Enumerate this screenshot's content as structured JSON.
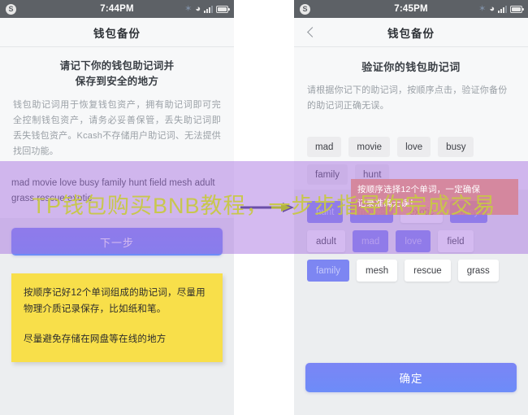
{
  "left_phone": {
    "status_bar": {
      "badge": "S",
      "time": "7:44PM",
      "bluetooth_icon": "bluetooth-icon",
      "wifi_icon": "wifi-icon",
      "signal_icon": "signal-icon",
      "battery_icon": "battery-icon"
    },
    "nav": {
      "title": "钱包备份"
    },
    "hero": {
      "title_line1": "请记下你的钱包助记词并",
      "title_line2": "保存到安全的地方",
      "description": "钱包助记词用于恢复钱包资产，拥有助记词即可完全控制钱包资产，请务必妥善保管，丢失助记词即丢失钱包资产。Kcash不存储用户助记词、无法提供找回功能。"
    },
    "mnemonic": {
      "line1": "mad movie love busy family hunt field mesh adult",
      "line2": "grass rescue exotic",
      "words": [
        "mad",
        "movie",
        "love",
        "busy",
        "family",
        "hunt",
        "field",
        "mesh",
        "adult",
        "grass",
        "rescue",
        "exotic"
      ]
    },
    "next_button": "下一步",
    "note": {
      "paragraph1": "按顺序记好12个单词组成的助记词，尽量用物理介质记录保存，比如纸和笔。",
      "paragraph2": "尽量避免存储在网盘等在线的地方"
    }
  },
  "right_phone": {
    "status_bar": {
      "badge": "S",
      "time": "7:45PM",
      "bluetooth_icon": "bluetooth-icon",
      "wifi_icon": "wifi-icon",
      "signal_icon": "signal-icon",
      "battery_icon": "battery-icon"
    },
    "nav": {
      "title": "钱包备份",
      "back_icon": "back-chevron-icon"
    },
    "hero": {
      "title": "验证你的钱包助记词",
      "description": "请根据你记下的助记词，按顺序点击，验证你备份的助记词正确无误。"
    },
    "selected_words": [
      "mad",
      "movie",
      "love",
      "busy",
      "family",
      "hunt"
    ],
    "word_bank": [
      {
        "label": "hunt",
        "used": true
      },
      {
        "label": "movie",
        "used": true
      },
      {
        "label": "exotic",
        "used": false
      },
      {
        "label": "busy",
        "used": true
      },
      {
        "label": "adult",
        "used": false
      },
      {
        "label": "mad",
        "used": true
      },
      {
        "label": "love",
        "used": true
      },
      {
        "label": "field",
        "used": false
      },
      {
        "label": "family",
        "used": true
      },
      {
        "label": "mesh",
        "used": false
      },
      {
        "label": "rescue",
        "used": false
      },
      {
        "label": "grass",
        "used": false
      }
    ],
    "confirm_button": "确定"
  },
  "overlays": {
    "tooltip_line1": "按顺序选择12个单词，一定确保",
    "tooltip_line2": "记录准确无误！",
    "watermark_text": "TP钱包购买BNB教程，一步步指导你完成交易",
    "arrow_icon": "right-arrow-icon"
  },
  "colors": {
    "status_bar_bg": "#5d6166",
    "page_bg": "#eceef0",
    "card_bg": "#f7f8f9",
    "primary_button": "#7280f5",
    "note_yellow": "#f8df4a",
    "chip_used": "#7d86f2",
    "overlay_purple": "#a66ee0",
    "tooltip_pink": "#d67e8e",
    "watermark_olive": "#c8c845"
  }
}
